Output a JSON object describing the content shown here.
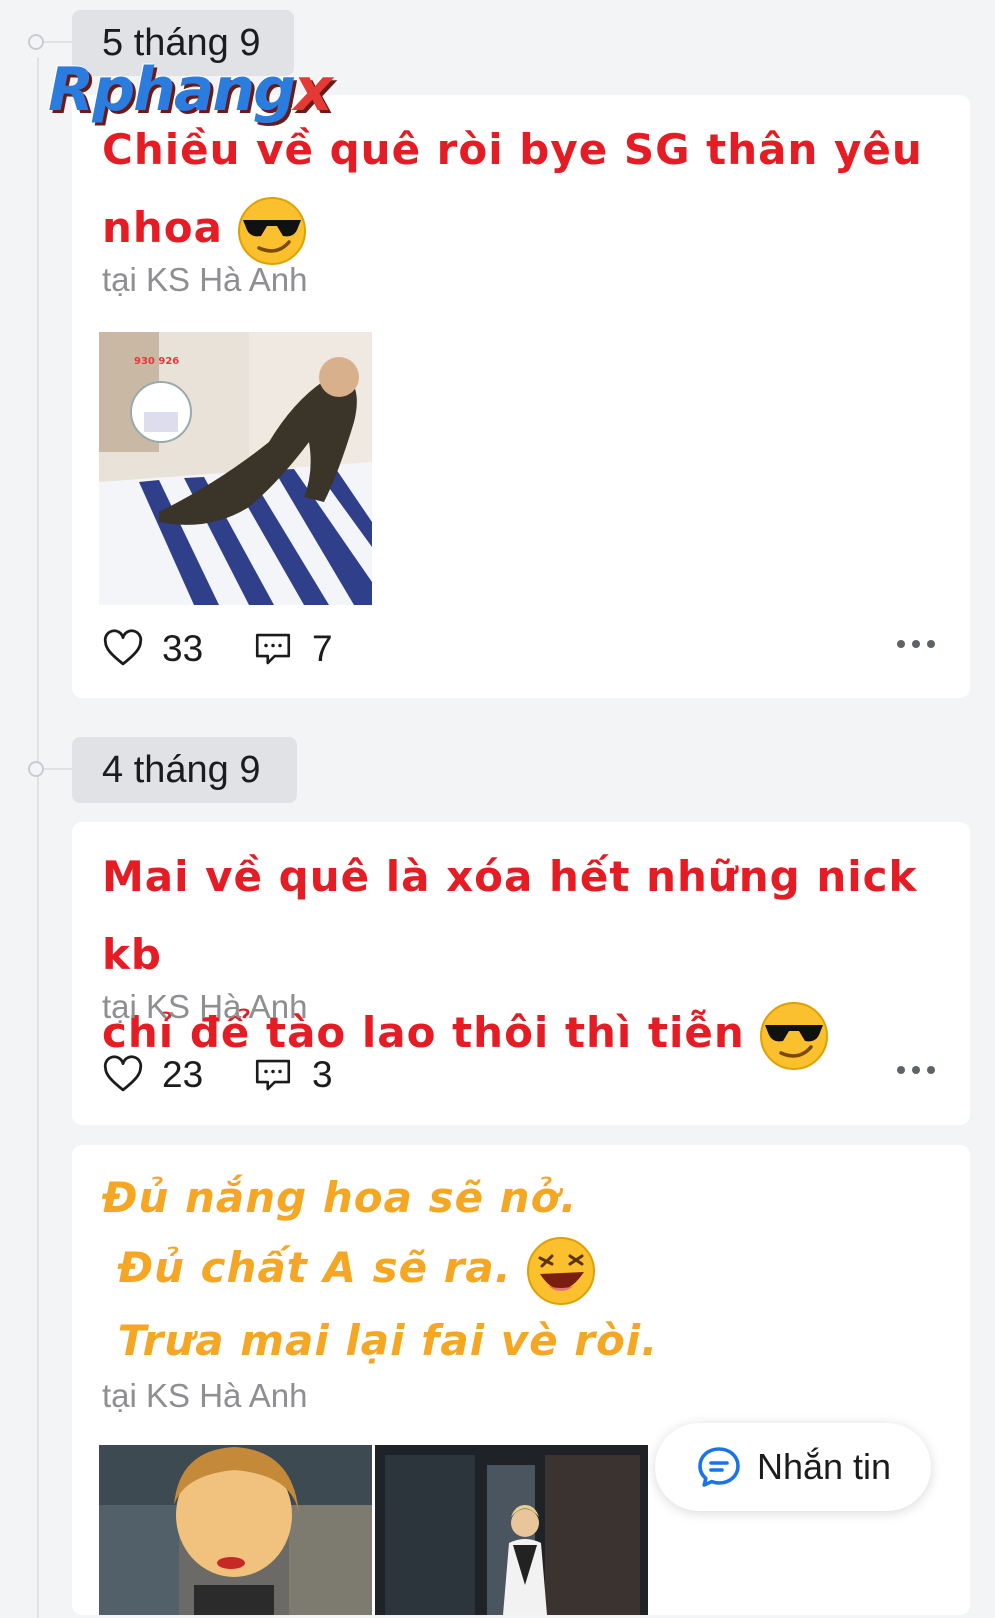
{
  "watermark": "Rphang",
  "watermark_x": "x",
  "colors": {
    "post_red": "#e51c23",
    "post_orange": "#f5a623",
    "location_gray": "#8e8e93",
    "accent_blue": "#1a73e8"
  },
  "posts": [
    {
      "date": "5 tháng 9",
      "text_line1": "Chiều về quê ròi bye SG thân yêu",
      "text_line2": "nhoa",
      "emoji": "sunglasses-emoji",
      "location": "tại KS Hà Anh",
      "likes": "33",
      "comments": "7"
    },
    {
      "date": "4 tháng 9",
      "text_line1": "Mai về quê là xóa hết những nick kb",
      "text_line2": "chỉ để tào lao thôi thì tiễn",
      "emoji": "sunglasses-emoji",
      "location": "tại KS Hà Anh",
      "likes": "23",
      "comments": "3"
    },
    {
      "text_line1": "Đủ nắng hoa sẽ nở.",
      "text_line2": " Đủ chất A sẽ ra.",
      "text_line3": " Trưa mai lại fai vè ròi.",
      "emoji": "laughing-emoji",
      "location": "tại KS Hà Anh"
    }
  ],
  "message_button": {
    "label": "Nhắn tin",
    "icon": "chat-bubble-icon"
  }
}
